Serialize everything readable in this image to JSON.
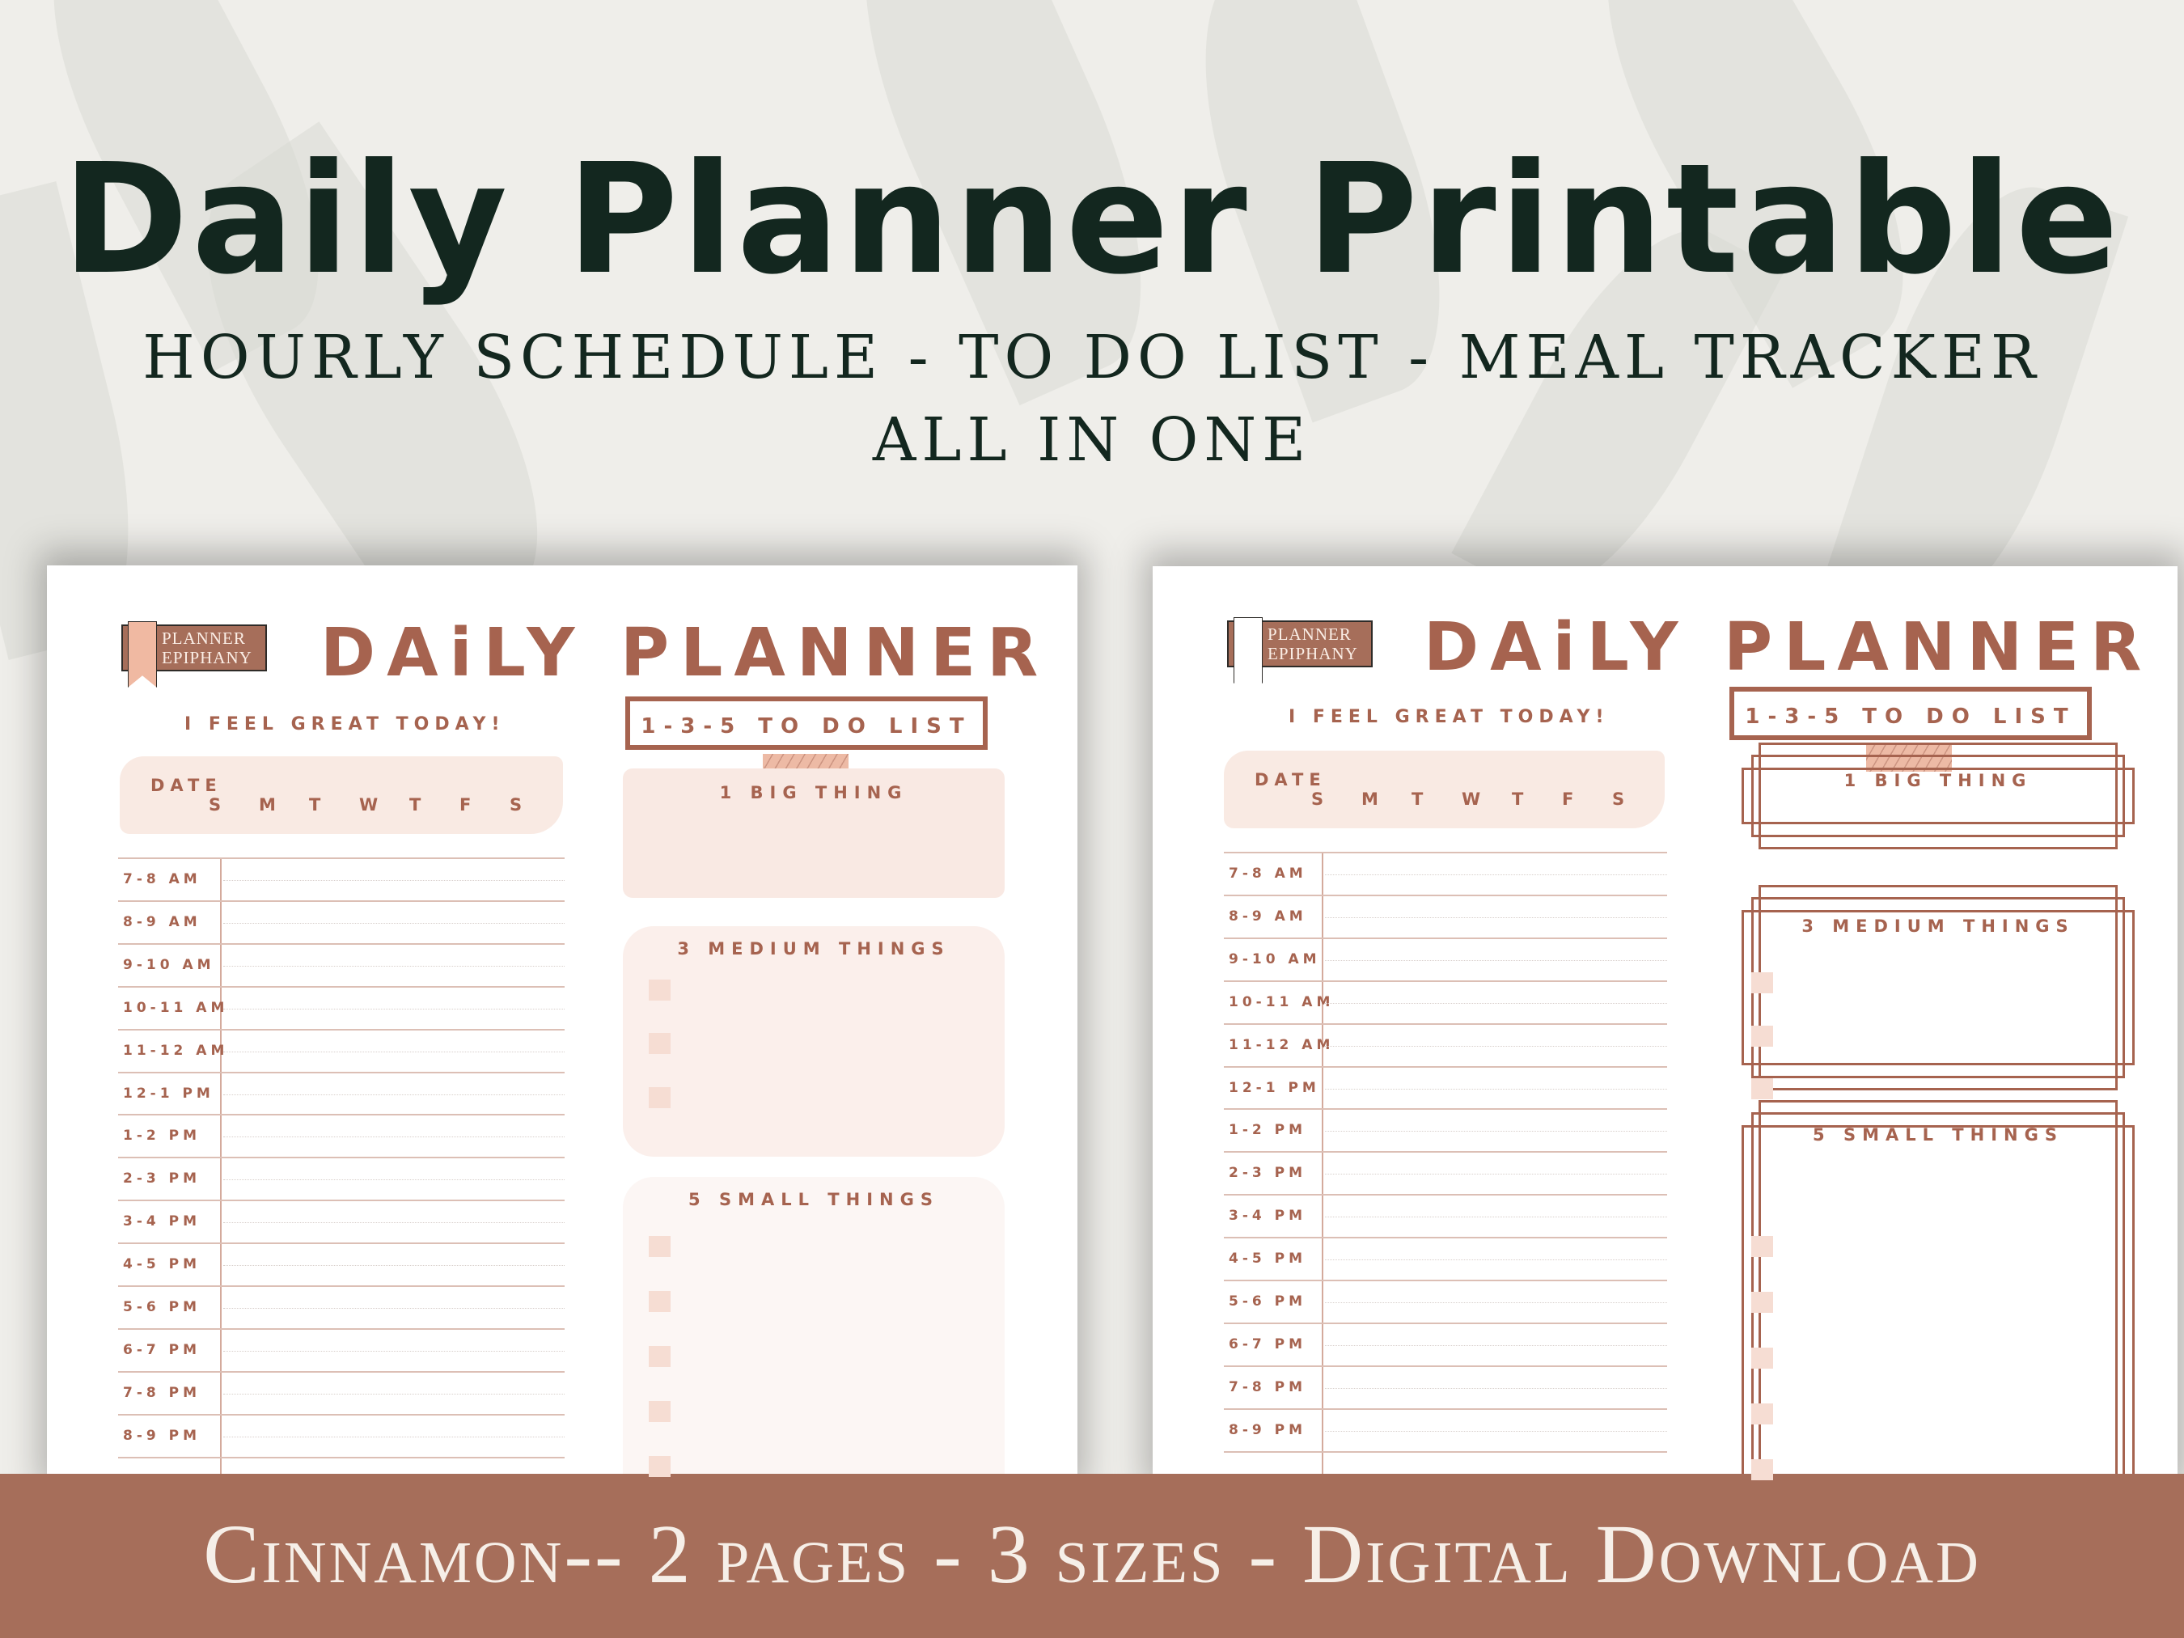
{
  "header": {
    "title": "Daily Planner Printable",
    "subtitle_line1": "HOURLY SCHEDULE - TO DO LIST - MEAL TRACKER",
    "subtitle_line2": "ALL IN ONE"
  },
  "colors": {
    "background": "#efeeea",
    "title": "#13271f",
    "accent_brown": "#a6634f",
    "banner": "#a66e5a",
    "blush": "#f8e6de"
  },
  "pages": [
    {
      "variant": "filled",
      "logo": {
        "line1": "PLANNER",
        "line2": "EPIPHANY"
      },
      "title": "DAiLY PLANNER",
      "feel": "I FEEL GREAT TODAY!",
      "date_label": "DATE",
      "days": [
        "S",
        "M",
        "T",
        "W",
        "T",
        "F",
        "S"
      ],
      "schedule": [
        "7-8 AM",
        "8-9 AM",
        "9-10 AM",
        "10-11 AM",
        "11-12 AM",
        "12-1 PM",
        "1-2 PM",
        "2-3 PM",
        "3-4 PM",
        "4-5 PM",
        "5-6 PM",
        "6-7 PM",
        "7-8 PM",
        "8-9 PM"
      ],
      "todo_header": "1-3-5 TO DO LIST",
      "big_thing": "1 BIG THING",
      "medium_things": "3 MEDIUM THINGS",
      "small_things": "5 SMALL THINGS"
    },
    {
      "variant": "outlined",
      "logo": {
        "line1": "PLANNER",
        "line2": "EPIPHANY"
      },
      "title": "DAiLY PLANNER",
      "feel": "I FEEL GREAT TODAY!",
      "date_label": "DATE",
      "days": [
        "S",
        "M",
        "T",
        "W",
        "T",
        "F",
        "S"
      ],
      "schedule": [
        "7-8 AM",
        "8-9 AM",
        "9-10 AM",
        "10-11 AM",
        "11-12 AM",
        "12-1 PM",
        "1-2 PM",
        "2-3 PM",
        "3-4 PM",
        "4-5 PM",
        "5-6 PM",
        "6-7 PM",
        "7-8 PM",
        "8-9 PM"
      ],
      "todo_header": "1-3-5 TO DO LIST",
      "big_thing": "1 BIG THING",
      "medium_things": "3 MEDIUM THINGS",
      "small_things": "5 SMALL THINGS"
    }
  ],
  "banner": {
    "text": "Cinnamon-- 2 pages - 3 sizes - Digital Download"
  }
}
